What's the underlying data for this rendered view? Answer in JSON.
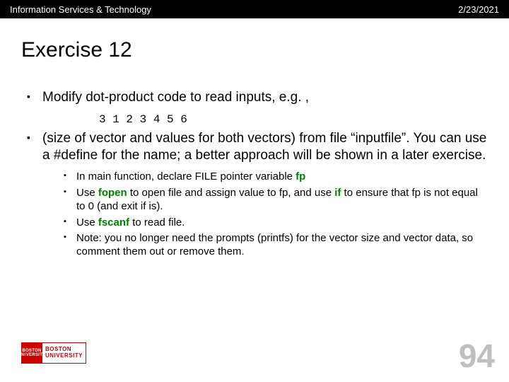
{
  "header": {
    "org": "Information Services & Technology",
    "date": "2/23/2021"
  },
  "title": "Exercise 12",
  "bullets": {
    "b1": "Modify  dot-product code to read inputs, e.g. ,",
    "mono": "3 1 2 3 4 5 6",
    "b2a": " (size of vector and values for both vectors) from file “inputfile”.  You can use a #define for the name;  a better approach will be shown in a later exercise.",
    "s1a": "In main function, declare FILE pointer variable ",
    "s1kw": "fp",
    "s2a": "Use ",
    "s2kw1": "fopen",
    "s2b": " to open file and assign value to fp, and use ",
    "s2kw2": "if",
    "s2c": " to ensure that fp is not equal to 0 (and exit if is).",
    "s3a": "Use ",
    "s3kw": "fscanf",
    "s3b": " to read file.",
    "s4": "Note: you no longer need the prompts (printfs) for the vector size and vector data, so comment them out or remove them."
  },
  "logo": {
    "l1": "BOSTON",
    "l2": "UNIVERSITY"
  },
  "page": "94"
}
